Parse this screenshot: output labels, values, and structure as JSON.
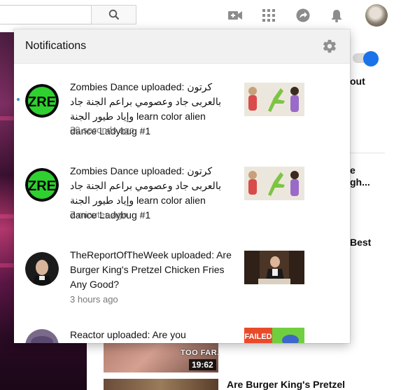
{
  "topbar": {
    "search": {
      "value": "",
      "placeholder": ""
    },
    "icons": [
      "search-icon",
      "video-camera-icon",
      "apps-grid-icon",
      "share-arrow-icon",
      "bell-icon"
    ]
  },
  "background": {
    "peek_texts": [
      "out",
      "e",
      "gh...",
      "Best"
    ],
    "duration": "19:62",
    "thumb_overlay_text": "TOO FAR.",
    "below_title": "Are Burger King's Pretzel",
    "colors": {
      "autoplay_on": "#1a73e8"
    }
  },
  "panel": {
    "title": "Notifications",
    "settings_icon": "gear-icon",
    "items": [
      {
        "text": "Zombies Dance uploaded: كرتون بالعربى جاد وعصومي براعم الجنة جاد وإياد طيور الجنة learn color alien dance Ladybug #1",
        "time": "20 seconds ago",
        "avatar_text": "ZRE",
        "unread": true
      },
      {
        "text": "Zombies Dance uploaded: كرتون بالعربى جاد وعصومي براعم الجنة جاد وإياد طيور الجنة learn color alien dance Ladybug #1",
        "time": "7 minutes ago",
        "avatar_text": "ZRE",
        "unread": false
      },
      {
        "text": "TheReportOfTheWeek uploaded: Are Burger King's Pretzel Chicken Fries Any Good?",
        "time": "3 hours ago",
        "unread": false
      },
      {
        "text": "Reactor uploaded: Are you",
        "thumb_text": "FAILED",
        "unread": false
      }
    ]
  }
}
